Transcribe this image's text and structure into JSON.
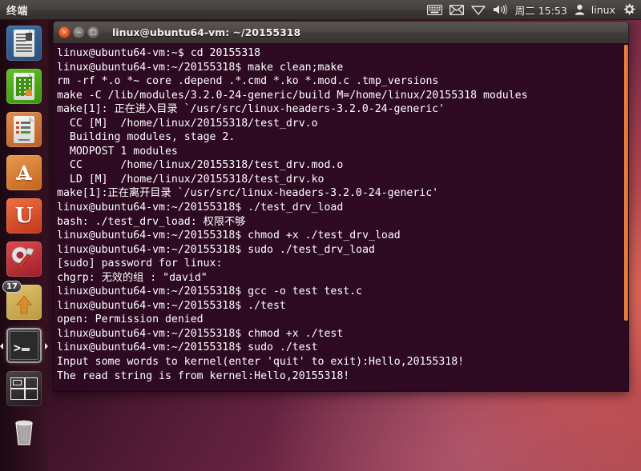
{
  "panel": {
    "title": "终端",
    "tray": {
      "keyboard_icon": "keyboard-icon",
      "mail_icon": "envelope-icon",
      "network_icon": "wifi-icon",
      "volume_icon": "speaker-icon",
      "clock": "周二 15:53",
      "user_icon": "user-icon",
      "username": "linux",
      "settings_icon": "gear-icon"
    }
  },
  "launcher": {
    "items": [
      {
        "name": "libreoffice-writer",
        "label": "LibreOffice Writer",
        "glyph": ""
      },
      {
        "name": "libreoffice-calc",
        "label": "LibreOffice Calc",
        "glyph": ""
      },
      {
        "name": "libreoffice-impress",
        "label": "LibreOffice Impress",
        "glyph": ""
      },
      {
        "name": "ubuntu-software-center",
        "label": "Ubuntu Software Center",
        "glyph": "A"
      },
      {
        "name": "ubuntu-one",
        "label": "Ubuntu One",
        "glyph": "U"
      },
      {
        "name": "system-settings",
        "label": "System Settings",
        "glyph": ""
      },
      {
        "name": "update-manager",
        "label": "Update Manager",
        "glyph": "",
        "badge": "17"
      },
      {
        "name": "terminal",
        "label": "Terminal",
        "glyph": ""
      },
      {
        "name": "workspace-switcher",
        "label": "Workspace Switcher",
        "glyph": ""
      },
      {
        "name": "trash",
        "label": "Trash",
        "glyph": ""
      }
    ]
  },
  "window": {
    "title": "linux@ubuntu64-vm: ~/20155318",
    "close_label": "×",
    "minimize_label": "−",
    "maximize_label": "□"
  },
  "terminal": {
    "lines": [
      "linux@ubuntu64-vm:~$ cd 20155318",
      "linux@ubuntu64-vm:~/20155318$ make clean;make",
      "rm -rf *.o *~ core .depend .*.cmd *.ko *.mod.c .tmp_versions",
      "make -C /lib/modules/3.2.0-24-generic/build M=/home/linux/20155318 modules",
      "make[1]: 正在进入目录 `/usr/src/linux-headers-3.2.0-24-generic'",
      "  CC [M]  /home/linux/20155318/test_drv.o",
      "  Building modules, stage 2.",
      "  MODPOST 1 modules",
      "  CC      /home/linux/20155318/test_drv.mod.o",
      "  LD [M]  /home/linux/20155318/test_drv.ko",
      "make[1]:正在离开目录 `/usr/src/linux-headers-3.2.0-24-generic'",
      "linux@ubuntu64-vm:~/20155318$ ./test_drv_load",
      "bash: ./test_drv_load: 权限不够",
      "linux@ubuntu64-vm:~/20155318$ chmod +x ./test_drv_load",
      "linux@ubuntu64-vm:~/20155318$ sudo ./test_drv_load",
      "[sudo] password for linux:",
      "chgrp: 无效的组 : \"david\"",
      "linux@ubuntu64-vm:~/20155318$ gcc -o test test.c",
      "linux@ubuntu64-vm:~/20155318$ ./test",
      "open: Permission denied",
      "linux@ubuntu64-vm:~/20155318$ chmod +x ./test",
      "linux@ubuntu64-vm:~/20155318$ sudo ./test",
      "Input some words to kernel(enter 'quit' to exit):Hello,20155318!",
      "The read string is from kernel:Hello,20155318!"
    ]
  },
  "colors": {
    "terminal_bg": "#2d0922",
    "terminal_fg": "#ffffff",
    "panel_bg": "#413c39",
    "scrollbar": "#e2671f",
    "accent_orange": "#df4a17"
  }
}
